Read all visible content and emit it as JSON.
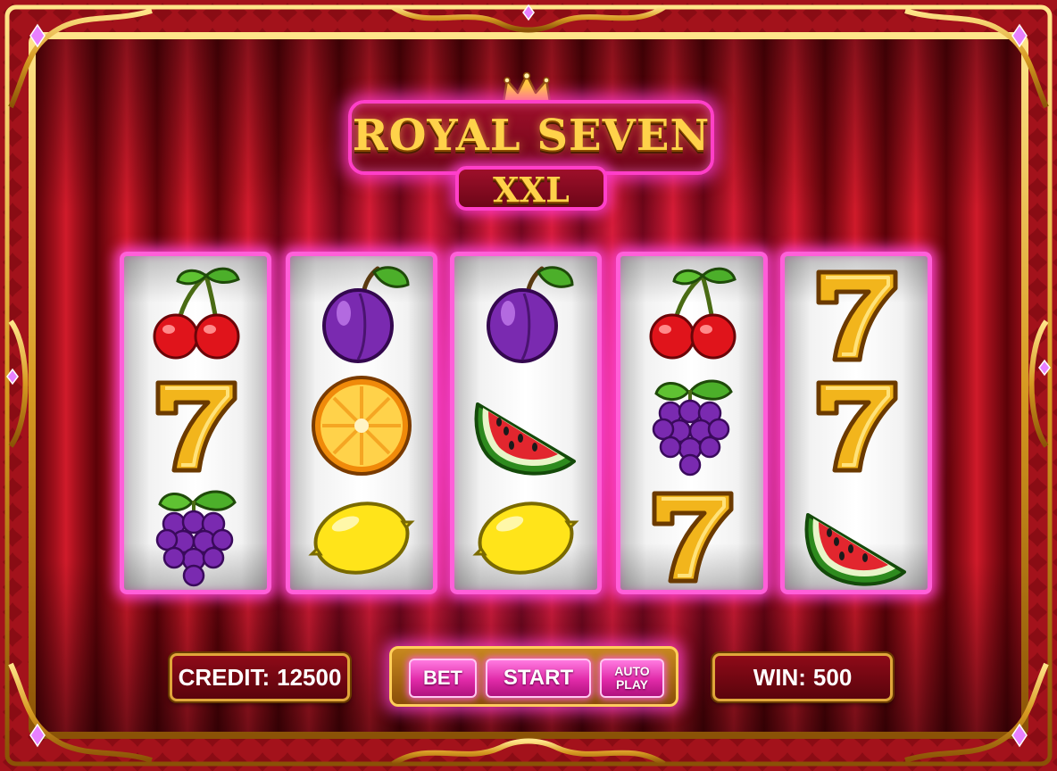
{
  "title": {
    "line1": "ROYAL SEVEN",
    "line2": "XXL"
  },
  "reels": [
    [
      "cherry-icon",
      "seven-icon",
      "grapes-icon"
    ],
    [
      "plum-icon",
      "orange-icon",
      "lemon-icon"
    ],
    [
      "plum-icon",
      "watermelon-icon",
      "lemon-icon"
    ],
    [
      "cherry-icon",
      "grapes-icon",
      "seven-icon"
    ],
    [
      "seven-icon",
      "seven-icon",
      "watermelon-icon"
    ]
  ],
  "credit": {
    "label": "CREDIT:",
    "value": "12500"
  },
  "win": {
    "label": "WIN:",
    "value": "500"
  },
  "buttons": {
    "bet": "BET",
    "start": "START",
    "auto": "AUTO\nPLAY"
  },
  "colors": {
    "neon": "#ff3fc8",
    "gold": "#ffd24a",
    "background": "#7a0c12"
  }
}
